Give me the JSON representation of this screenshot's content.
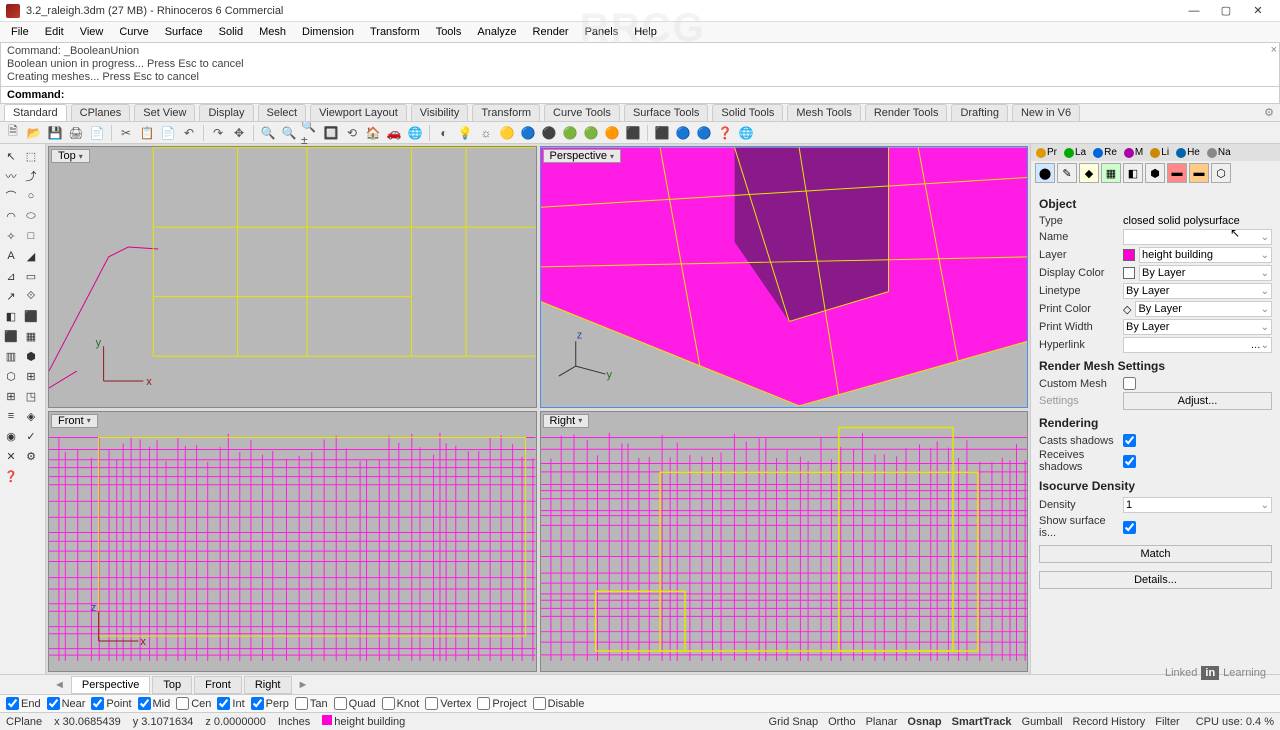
{
  "window": {
    "title": "3.2_raleigh.3dm (27 MB) - Rhinoceros 6 Commercial",
    "min": "—",
    "max": "▢",
    "close": "✕"
  },
  "menu": [
    "File",
    "Edit",
    "View",
    "Curve",
    "Surface",
    "Solid",
    "Mesh",
    "Dimension",
    "Transform",
    "Tools",
    "Analyze",
    "Render",
    "Panels",
    "Help"
  ],
  "cmdhist": [
    "Command: _BooleanUnion",
    "Boolean union in progress... Press Esc to cancel",
    "Creating meshes... Press Esc to cancel"
  ],
  "cmdprompt": "Command:",
  "ribbon": {
    "tabs": [
      "Standard",
      "CPlanes",
      "Set View",
      "Display",
      "Select",
      "Viewport Layout",
      "Visibility",
      "Transform",
      "Curve Tools",
      "Surface Tools",
      "Solid Tools",
      "Mesh Tools",
      "Render Tools",
      "Drafting",
      "New in V6"
    ],
    "active": 0
  },
  "iconbar": [
    "🗎",
    "📂",
    "💾",
    "🖨",
    "📄",
    "✂",
    "📋",
    "📄",
    "↶",
    "↷",
    "✥",
    "🔍",
    "🔍",
    "🔍±",
    "🔲",
    "⟲",
    "🏠",
    "🚗",
    "🌐",
    "◐",
    "💡",
    "☼",
    "🟡",
    "🔵",
    "⚫",
    "🟢",
    "🟢",
    "🟠",
    "⬛",
    "⬛",
    "🔵",
    "🔵",
    "❓",
    "🌐"
  ],
  "lefttools": [
    "↖",
    "⬚",
    "〰",
    "⤴",
    "⌒",
    "○",
    "◠",
    "⬭",
    "✧",
    "□",
    "A",
    "◢",
    "⊿",
    "▭",
    "↗",
    "⟐",
    "◧",
    "⬛",
    "⬛",
    "▦",
    "▥",
    "⬢",
    "⬡",
    "⊞",
    "⊞",
    "◳",
    "≡",
    "◈",
    "◉",
    "✓",
    "✕",
    "⚙",
    "❓"
  ],
  "viewports": {
    "top": "Top",
    "perspective": "Perspective",
    "front": "Front",
    "right": "Right"
  },
  "rightpanel": {
    "tabs": [
      "Pr",
      "La",
      "Re",
      "M",
      "Li",
      "He",
      "Na"
    ],
    "object": {
      "heading": "Object",
      "type_label": "Type",
      "type_value": "closed solid polysurface",
      "name_label": "Name",
      "name_value": "",
      "layer_label": "Layer",
      "layer_value": "height building",
      "layer_color": "#ff00d4",
      "dispcolor_label": "Display Color",
      "dispcolor_value": "By Layer",
      "linetype_label": "Linetype",
      "linetype_value": "By Layer",
      "printcolor_label": "Print Color",
      "printcolor_value": "By Layer",
      "printwidth_label": "Print Width",
      "printwidth_value": "By Layer",
      "hyperlink_label": "Hyperlink"
    },
    "mesh": {
      "heading": "Render Mesh Settings",
      "custom_label": "Custom Mesh",
      "settings_label": "Settings",
      "adjust": "Adjust..."
    },
    "rendering": {
      "heading": "Rendering",
      "casts": "Casts shadows",
      "receives": "Receives shadows"
    },
    "iso": {
      "heading": "Isocurve Density",
      "density_label": "Density",
      "density_value": "1",
      "show_label": "Show surface is..."
    },
    "match": "Match",
    "details": "Details..."
  },
  "viewtabs": [
    "Perspective",
    "Top",
    "Front",
    "Right"
  ],
  "osnap": {
    "items": [
      {
        "label": "End",
        "on": true
      },
      {
        "label": "Near",
        "on": true
      },
      {
        "label": "Point",
        "on": true
      },
      {
        "label": "Mid",
        "on": true
      },
      {
        "label": "Cen",
        "on": false
      },
      {
        "label": "Int",
        "on": true
      },
      {
        "label": "Perp",
        "on": true
      },
      {
        "label": "Tan",
        "on": false
      },
      {
        "label": "Quad",
        "on": false
      },
      {
        "label": "Knot",
        "on": false
      },
      {
        "label": "Vertex",
        "on": false
      },
      {
        "label": "Project",
        "on": false
      },
      {
        "label": "Disable",
        "on": false
      }
    ]
  },
  "status": {
    "cplane": "CPlane",
    "x": "x 30.0685439",
    "y": "y 3.1071634",
    "z": "z 0.0000000",
    "units": "Inches",
    "layer": "height building",
    "toggles": [
      "Grid Snap",
      "Ortho",
      "Planar",
      "Osnap",
      "SmartTrack",
      "Gumball",
      "Record History",
      "Filter"
    ],
    "toggles_on": [
      3,
      4
    ],
    "cpu": "CPU use: 0.4 %"
  },
  "watermark": "RRCG",
  "learning": {
    "linked": "Linked",
    "in": "in",
    "learn": "Learning"
  }
}
